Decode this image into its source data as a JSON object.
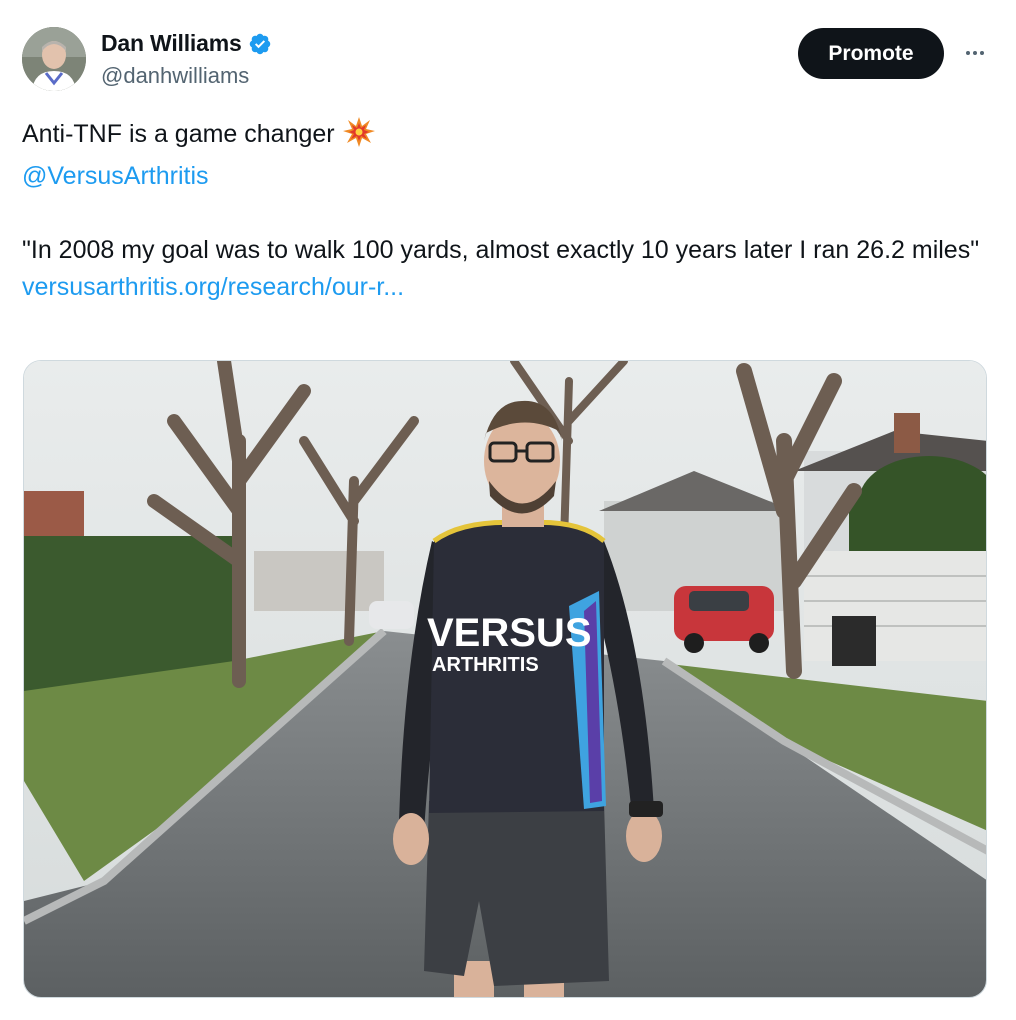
{
  "author": {
    "display_name": "Dan Williams",
    "handle": "@danhwilliams",
    "verified": true,
    "verified_color": "#1d9bf0",
    "avatar_icon": "avatar-photo"
  },
  "actions": {
    "promote_label": "Promote",
    "more_icon": "more-icon"
  },
  "tweet": {
    "line1": "Anti-TNF is a game changer",
    "line1_emoji": "collision-emoji",
    "mention": "@VersusArthritis",
    "quote": "\"In 2008 my goal was to walk 100 yards, almost exactly 10 years later I ran 26.2 miles\"",
    "link": "versusarthritis.org/research/our-r..."
  },
  "media": {
    "shirt_text_line1": "VERSUS",
    "shirt_text_line2": "ARTHRITIS"
  },
  "colors": {
    "text": "#0f1419",
    "secondary": "#536471",
    "link": "#1d9bf0",
    "button_bg": "#0f1419"
  }
}
